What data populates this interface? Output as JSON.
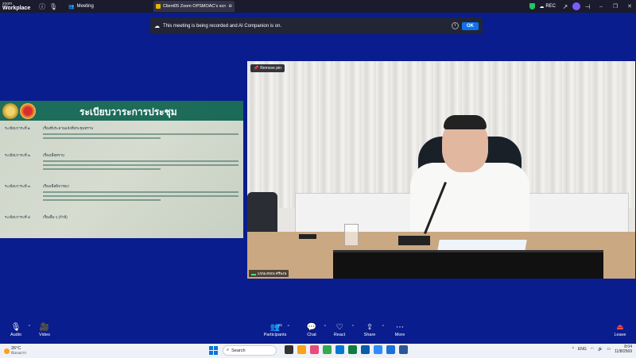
{
  "titlebar": {
    "brand_line1": "zoom",
    "brand_line2": "Workplace",
    "meeting_label": "Meeting",
    "tab_label": "Client05 Zoom OPSMOAC's scree",
    "rec_label": "REC",
    "icons": [
      "info-icon",
      "mic-icon",
      "meeting-icon",
      "shield-icon",
      "cloud-icon",
      "share-icon",
      "pin-icon",
      "avatar",
      "minimize-icon",
      "maximize-icon",
      "close-icon"
    ]
  },
  "notice": {
    "text": "This meeting is being recorded and AI Companion is on.",
    "ok_label": "OK"
  },
  "share": {
    "title": "ระเบียบวาระการประชุม",
    "rows": [
      {
        "label": "ระเบียบวาระที่ ๑",
        "heading": "เรื่องที่ประธานแจ้งที่ประชุมทราบ"
      },
      {
        "label": "ระเบียบวาระที่ ๒",
        "heading": "เรื่องเพื่อทราบ"
      },
      {
        "label": "ระเบียบวาระที่ ๓",
        "heading": "เรื่องเพื่อพิจารณา"
      },
      {
        "label": "ระเบียบวาระที่ ๔",
        "heading": "เรื่องอื่น ๆ (ถ้ามี)"
      }
    ]
  },
  "video": {
    "remove_pin_label": "Remove pin",
    "participant_name": "แฟนเงทอน ศรีพงษ"
  },
  "toolbar": {
    "audio": "Audio",
    "video": "Video",
    "participants": "Participants",
    "participants_count": "21",
    "chat": "Chat",
    "react": "React",
    "share": "Share",
    "more": "More",
    "leave": "Leave"
  },
  "taskbar": {
    "temperature": "26°C",
    "condition": "มีเมฆมาก",
    "search_placeholder": "Search",
    "language": "ENG",
    "time": "8:04",
    "date": "11/8/2569"
  },
  "colors": {
    "background": "#0a1d8e",
    "accent": "#0e72ed",
    "slide_header": "#1f6d5c"
  }
}
